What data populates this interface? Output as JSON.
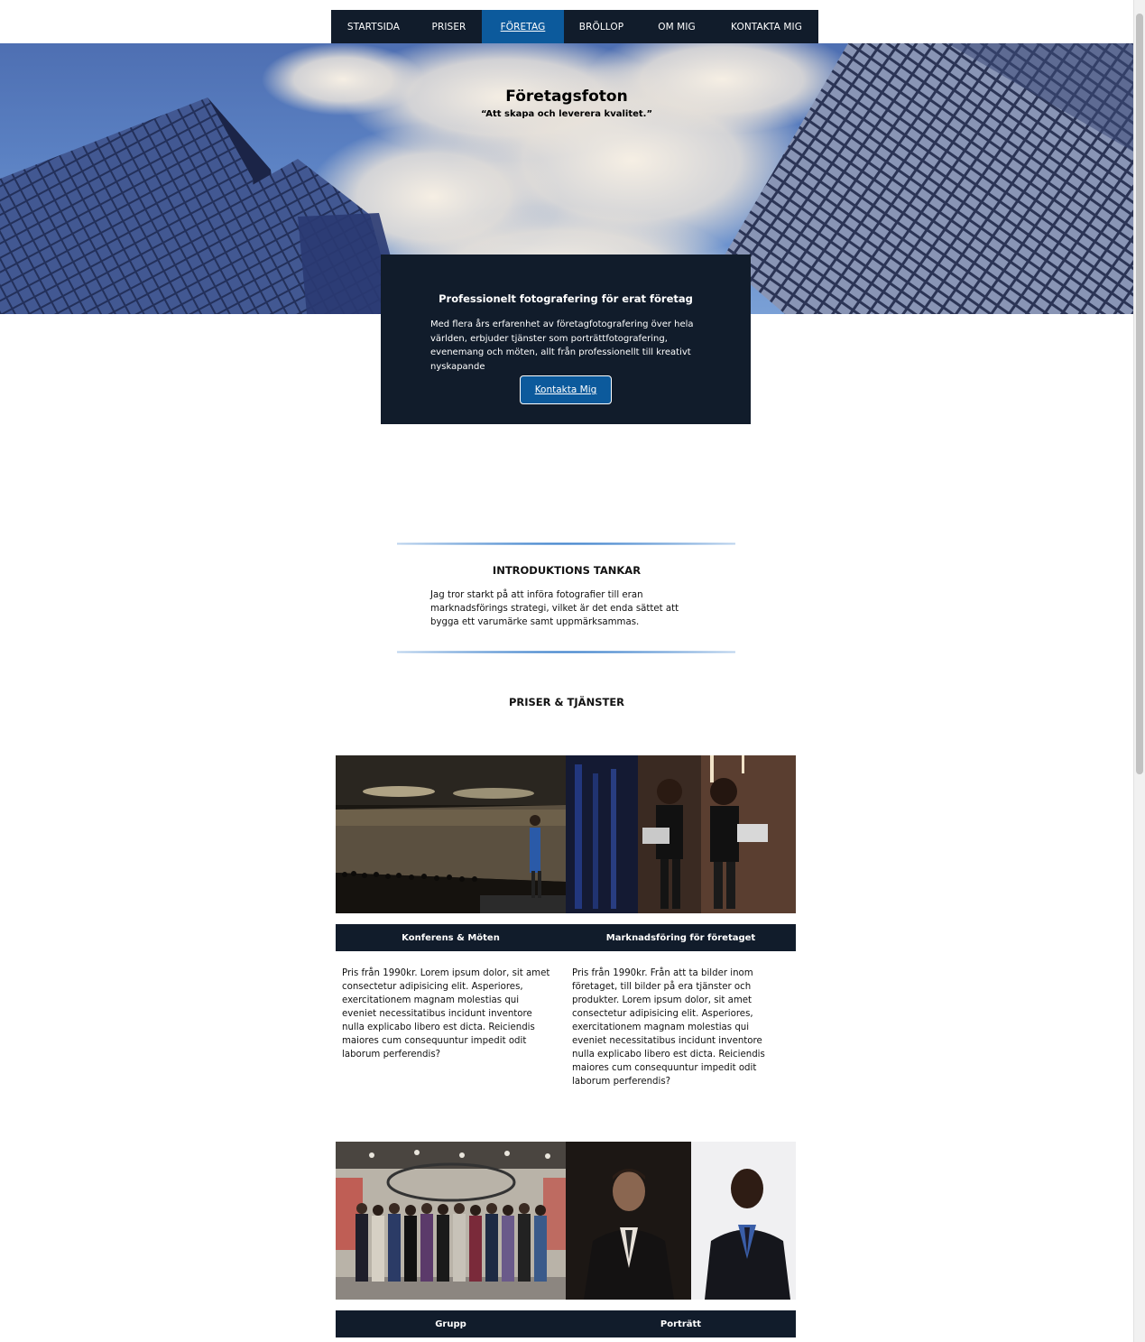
{
  "nav": {
    "items": [
      {
        "label": "STARTSIDA"
      },
      {
        "label": "PRISER"
      },
      {
        "label": "FÖRETAG"
      },
      {
        "label": "BRÖLLOP"
      },
      {
        "label": "OM MIG"
      },
      {
        "label": "KONTAKTA MIG"
      }
    ],
    "active_label": "FÖRETAG"
  },
  "hero": {
    "title": "Företagsfoton",
    "subtitle": "“Att skapa och leverera kvalitet.”"
  },
  "infobox": {
    "heading": "Professionelt fotografering för erat företag",
    "text": "Med flera års erfarenhet av företagfotografering över hela världen, erbjuder tjänster som porträttfotografering, evenemang och möten, allt från professionellt till kreativt nyskapande",
    "button": "Kontakta Mig"
  },
  "intro": {
    "title": "INTRODUKTIONS TANKAR",
    "text": "Jag tror starkt på att införa fotografier till eran marknadsförings strategi, vilket är det enda sättet att bygga ett varumärke samt uppmärksammas."
  },
  "prices": {
    "title": "PRISER & TJÄNSTER",
    "cards": [
      {
        "title": "Konferens & Möten",
        "text": "Pris från 1990kr. Lorem ipsum dolor, sit amet consectetur adipisicing elit. Asperiores, exercitationem magnam molestias qui eveniet necessitatibus incidunt inventore nulla explicabo libero est dicta. Reiciendis maiores cum consequuntur impedit odit laborum perferendis?"
      },
      {
        "title": "Marknadsföring för företaget",
        "text": "Pris från 1990kr. Från att ta bilder inom företaget, till bilder på era tjänster och produkter. Lorem ipsum dolor, sit amet consectetur adipisicing elit. Asperiores, exercitationem magnam molestias qui eveniet necessitatibus incidunt inventore nulla explicabo libero est dicta. Reiciendis maiores cum consequuntur impedit odit laborum perferendis?"
      },
      {
        "title": "Grupp"
      },
      {
        "title": "Porträtt"
      }
    ]
  },
  "colors": {
    "navy": "#111c2b",
    "accent": "#0c5a9c"
  }
}
